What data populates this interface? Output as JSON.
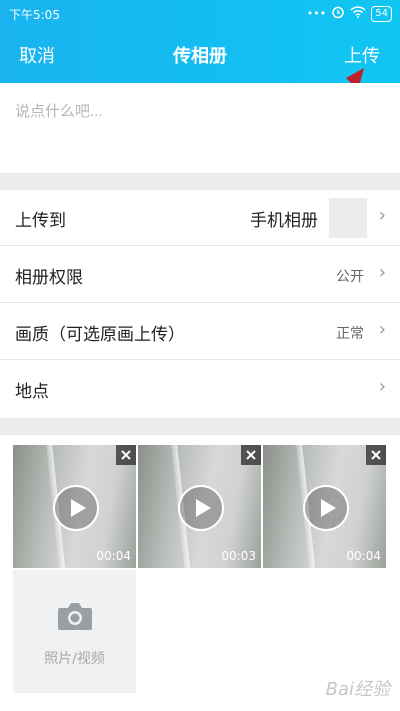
{
  "status_bar": {
    "time": "下午5:05",
    "dots": "•••",
    "battery": "54"
  },
  "nav": {
    "cancel_label": "取消",
    "title": "传相册",
    "upload_label": "上传"
  },
  "compose": {
    "placeholder": "说点什么吧..."
  },
  "settings": [
    {
      "label": "上传到",
      "value": "手机相册"
    },
    {
      "label": "相册权限",
      "value": "公开"
    },
    {
      "label": "画质（可选原画上传）",
      "value": "正常"
    },
    {
      "label": "地点",
      "value": ""
    }
  ],
  "media": [
    {
      "duration": "00:04"
    },
    {
      "duration": "00:03"
    },
    {
      "duration": "00:04"
    }
  ],
  "add_tile": {
    "caption": "照片/视频"
  },
  "icons": [
    "signal-icon",
    "alarm-icon",
    "wifi-icon",
    "battery-icon",
    "chevron-right-icon",
    "close-icon",
    "play-icon",
    "camera-icon"
  ],
  "colors": {
    "topbar": "#19b3f0",
    "annotation_arrow": "#c0202a"
  },
  "watermark": "Bai经验"
}
